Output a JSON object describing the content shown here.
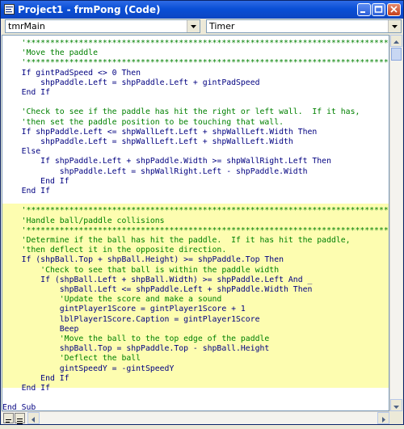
{
  "window": {
    "title": "Project1 - frmPong (Code)"
  },
  "object_combo": {
    "value": "tmrMain"
  },
  "procedure_combo": {
    "value": "Timer"
  },
  "code_lines": [
    "    '*******************************************************************************",
    "    'Move the paddle",
    "    '*******************************************************************************",
    "    If gintPadSpeed <> 0 Then",
    "        shpPaddle.Left = shpPaddle.Left + gintPadSpeed",
    "    End If",
    "",
    "    'Check to see if the paddle has hit the right or left wall.  If it has,",
    "    'then set the paddle position to be touching that wall.",
    "    If shpPaddle.Left <= shpWallLeft.Left + shpWallLeft.Width Then",
    "        shpPaddle.Left = shpWallLeft.Left + shpWallLeft.Width",
    "    Else",
    "        If shpPaddle.Left + shpPaddle.Width >= shpWallRight.Left Then",
    "            shpPaddle.Left = shpWallRight.Left - shpPaddle.Width",
    "        End If",
    "    End If",
    "",
    "    '*******************************************************************************",
    "    'Handle ball/paddle collisions",
    "    '*******************************************************************************",
    "    'Determine if the ball has hit the paddle.  If it has hit the paddle,",
    "    'then deflect it in the opposite direction.",
    "    If (shpBall.Top + shpBall.Height) >= shpPaddle.Top Then",
    "        'Check to see that ball is within the paddle width",
    "        If (shpBall.Left + shpBall.Width) >= shpPaddle.Left And _",
    "            shpBall.Left <= shpPaddle.Left + shpPaddle.Width Then",
    "            'Update the score and make a sound",
    "            gintPlayer1Score = gintPlayer1Score + 1",
    "            lblPlayer1Score.Caption = gintPlayer1Score",
    "            Beep",
    "            'Move the ball to the top edge of the paddle",
    "            shpBall.Top = shpPaddle.Top - shpBall.Height",
    "            'Deflect the ball",
    "            gintSpeedY = -gintSpeedY",
    "        End If",
    "    End If",
    "",
    "End Sub"
  ],
  "highlighted_section": "Handle ball/paddle collisions",
  "colors": {
    "comment": "#008000",
    "code": "#000080",
    "highlight": "#FDFDB0"
  },
  "icons": [
    "app-icon",
    "minimize-icon",
    "maximize-icon",
    "close-icon",
    "dropdown-arrow-icon",
    "scroll-up-icon",
    "scroll-down-icon",
    "scroll-left-icon",
    "scroll-right-icon",
    "procedure-view-icon",
    "full-module-view-icon"
  ]
}
